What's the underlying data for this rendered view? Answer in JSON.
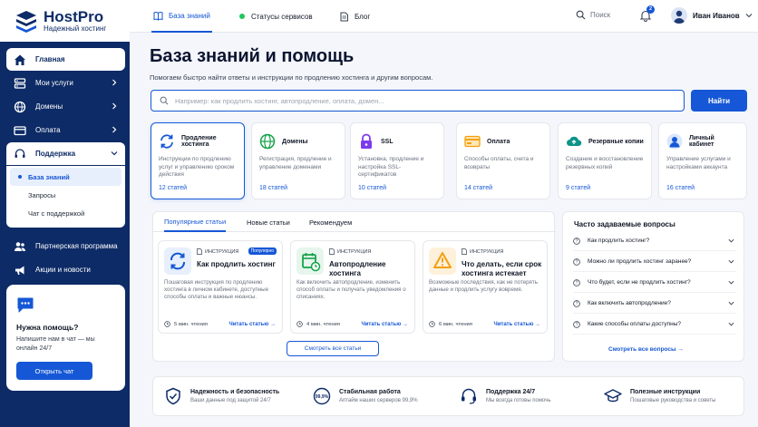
{
  "brand": {
    "name": "HostPro",
    "tagline": "Надежный хостинг"
  },
  "sidebar": {
    "items": [
      {
        "label": "Главная",
        "icon": "home-icon"
      },
      {
        "label": "Мои услуги",
        "icon": "server-icon"
      },
      {
        "label": "Домены",
        "icon": "globe-icon"
      },
      {
        "label": "Оплата",
        "icon": "card-icon"
      },
      {
        "label": "Поддержка",
        "icon": "headset-icon"
      }
    ],
    "support_sub": [
      "База знаний",
      "Запросы",
      "Чат с поддержкой"
    ],
    "extra": [
      {
        "label": "Партнерская программа",
        "icon": "users-icon"
      },
      {
        "label": "Акции и новости",
        "icon": "megaphone-icon"
      }
    ],
    "help": {
      "title": "Нужна помощь?",
      "text": "Напишите нам в чат — мы онлайн 24/7",
      "button": "Открыть чат"
    }
  },
  "topbar": {
    "tabs": [
      "База знаний",
      "Статусы сервисов",
      "Блог"
    ],
    "search_label": "Поиск",
    "notifications": "2",
    "user_name": "Иван Иванов"
  },
  "main": {
    "title": "База знаний и помощь",
    "subtitle": "Помогаем быстро найти ответы и инструкции по продлению хостинга и другим вопросам.",
    "search_placeholder": "Например: как продлить хостинг, автопродление, оплата, домен...",
    "search_button": "Найти"
  },
  "categories": [
    {
      "name": "Продление хостинга",
      "desc": "Инструкции по продлению услуг и управлению сроком действия",
      "count": "12 статей",
      "icon": "refresh-icon",
      "color": "#1557d6"
    },
    {
      "name": "Домены",
      "desc": "Регистрация, продление и управление доменами",
      "count": "18 статей",
      "icon": "globe-icon",
      "color": "#16a34a"
    },
    {
      "name": "SSL",
      "desc": "Установка, продление и настройка SSL-сертификатов",
      "count": "10 статей",
      "icon": "lock-icon",
      "color": "#7c3aed"
    },
    {
      "name": "Оплата",
      "desc": "Способы оплаты, счета и возвраты",
      "count": "14 статей",
      "icon": "card-icon",
      "color": "#f59e0b"
    },
    {
      "name": "Резервные копии",
      "desc": "Создание и восстановление резервных копий",
      "count": "9 статей",
      "icon": "cloud-icon",
      "color": "#0d9488"
    },
    {
      "name": "Личный кабинет",
      "desc": "Управление услугами и настройками аккаунта",
      "count": "16 статей",
      "icon": "user-icon",
      "color": "#1557d6"
    }
  ],
  "articles_panel": {
    "tabs": [
      "Популярные статьи",
      "Новые статьи",
      "Рекомендуем"
    ],
    "kind_label": "ИНСТРУКЦИЯ",
    "popular_badge": "Популярно",
    "read_label": "Читать статью →",
    "see_all": "Смотреть все статьи",
    "items": [
      {
        "title": "Как продлить хостинг",
        "desc": "Пошаговая инструкция по продлению хостинга в личном кабинете, доступные способы оплаты и важные нюансы.",
        "time": "5 мин. чтения",
        "icon": "refresh-icon"
      },
      {
        "title": "Автопродление хостинга",
        "desc": "Как включить автопродление, изменить способ оплаты и получать уведомления о списаниях.",
        "time": "4 мин. чтения",
        "icon": "calendar-check-icon"
      },
      {
        "title": "Что делать, если срок хостинга истекает",
        "desc": "Возможные последствия, как не потерять данные и продлить услугу вовремя.",
        "time": "6 мин. чтения",
        "icon": "warning-icon"
      }
    ]
  },
  "faq": {
    "title": "Часто задаваемые вопросы",
    "items": [
      "Как продлить хостинг?",
      "Можно ли продлить хостинг заранее?",
      "Что будет, если не продлить хостинг?",
      "Как включить автопродление?",
      "Какие способы оплаты доступны?"
    ],
    "all_link": "Смотреть все вопросы →"
  },
  "features": [
    {
      "title": "Надежность и безопасность",
      "sub": "Ваши данные под защитой 24/7",
      "icon": "shield-icon"
    },
    {
      "title": "Стабильная работа",
      "sub": "Аптайм наших серверов 99,9%",
      "icon": "uptime-icon",
      "badge": "99,9%"
    },
    {
      "title": "Поддержка 24/7",
      "sub": "Мы всегда готовы помочь",
      "icon": "headset-icon"
    },
    {
      "title": "Полезные инструкции",
      "sub": "Пошаговые руководства и советы",
      "icon": "graduation-icon"
    }
  ]
}
